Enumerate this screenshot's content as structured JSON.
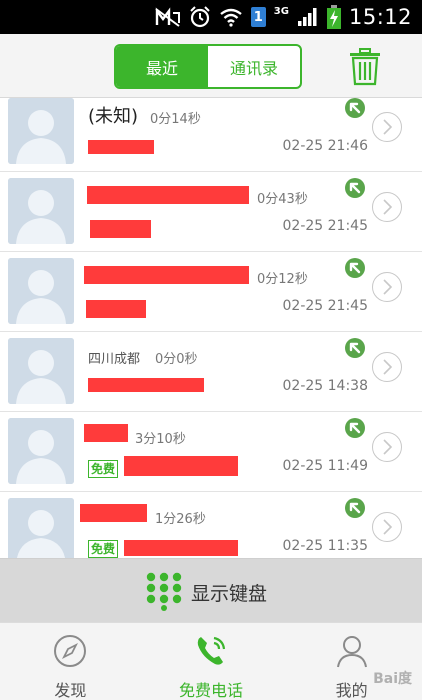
{
  "status_bar": {
    "time": "15:12",
    "sim_label": "1",
    "network_label": "3G"
  },
  "header": {
    "tabs": [
      {
        "label": "最近",
        "active": true
      },
      {
        "label": "通讯录",
        "active": false
      }
    ]
  },
  "calls": [
    {
      "name": "(未知)",
      "duration": "0分14秒",
      "time": "02-25 21:46",
      "free": false
    },
    {
      "name": "",
      "duration": "0分43秒",
      "time": "02-25 21:45",
      "free": false
    },
    {
      "name": "",
      "duration": "0分12秒",
      "time": "02-25 21:45",
      "free": false
    },
    {
      "name": "四川成都",
      "duration": "0分0秒",
      "time": "02-25 14:38",
      "free": false
    },
    {
      "name": "",
      "duration": "3分10秒",
      "time": "02-25 11:49",
      "free": true
    },
    {
      "name": "",
      "duration": "1分26秒",
      "time": "02-25 11:35",
      "free": true
    }
  ],
  "badge_label": "免费",
  "keypad": {
    "label": "显示键盘"
  },
  "nav": [
    {
      "label": "发现"
    },
    {
      "label": "免费电话"
    },
    {
      "label": "我的"
    }
  ],
  "colors": {
    "accent": "#3cb52c",
    "redaction": "#ff3b3b",
    "call_icon": "#5aa54b"
  }
}
